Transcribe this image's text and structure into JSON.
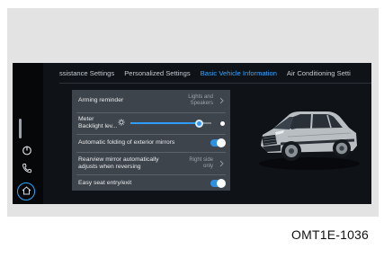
{
  "tabs": [
    {
      "label": "ssistance Settings",
      "active": false
    },
    {
      "label": "Personalized Settings",
      "active": false
    },
    {
      "label": "Basic Vehicle Information",
      "active": true
    },
    {
      "label": "Air Conditioning Setti",
      "active": false
    }
  ],
  "settings": {
    "arming_reminder": {
      "label": "Arming reminder",
      "value_line1": "Lights and",
      "value_line2": "Speakers"
    },
    "meter_backlight": {
      "label_line1": "Meter",
      "label_line2": "Backlight lev...",
      "level": 0.85
    },
    "auto_fold_mirrors": {
      "label": "Automatic folding of exterior mirrors",
      "on": true
    },
    "rearview_mirror": {
      "label_line1": "Rearview mirror automatically",
      "label_line2": "adjusts when reversing",
      "value_line1": "Right side",
      "value_line2": "only"
    },
    "easy_seat": {
      "label": "Easy seat entry/exit",
      "on": true
    }
  },
  "caption": "OMT1E-1036",
  "colors": {
    "accent": "#35a6ff",
    "toggle_on": "#2f8fe0",
    "card_bg": "#3e444b",
    "screen_bg": "#0f1216"
  },
  "icons": [
    "dial-icon",
    "phone-icon",
    "home-icon",
    "brightness-icon",
    "chevron-right-icon"
  ]
}
